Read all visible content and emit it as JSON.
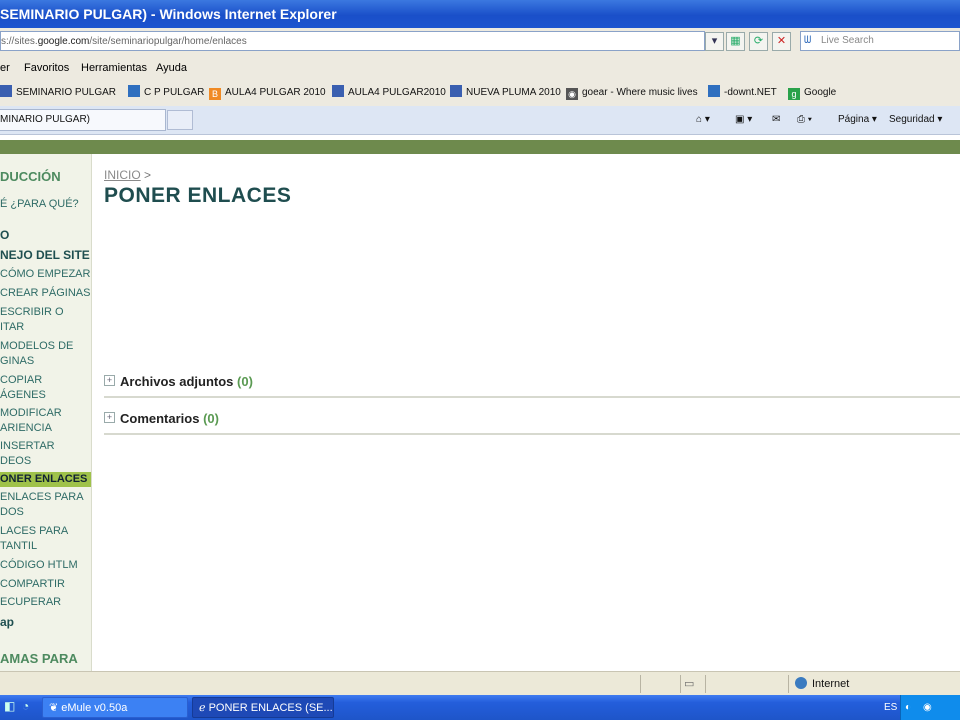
{
  "window": {
    "title": "SEMINARIO PULGAR) - Windows Internet Explorer"
  },
  "address": {
    "prefix": "s://sites.",
    "domain": "google.com",
    "path": "/site/seminariopulgar/home/enlaces",
    "search_placeholder": "Live Search"
  },
  "menu": {
    "items": [
      "er",
      "Favoritos",
      "Herramientas",
      "Ayuda"
    ]
  },
  "favorites": [
    {
      "label": "SEMINARIO PULGAR",
      "icon": "page-icon",
      "color": "#3a5fb0"
    },
    {
      "label": "C P PULGAR",
      "icon": "ie-page-icon",
      "color": "#2f6fbf"
    },
    {
      "label": "AULA4 PULGAR 2010",
      "icon": "blogger-icon",
      "color": "#f08a24"
    },
    {
      "label": "AULA4 PULGAR2010",
      "icon": "page-icon",
      "color": "#3a5fb0"
    },
    {
      "label": "NUEVA PLUMA 2010",
      "icon": "page-icon",
      "color": "#3a5fb0"
    },
    {
      "label": "goear - Where music lives",
      "icon": "goear-icon",
      "color": "#555555"
    },
    {
      "label": "-downt.NET",
      "icon": "ie-page-icon",
      "color": "#2f6fbf"
    },
    {
      "label": "Google",
      "icon": "google-icon",
      "color": "#2aa24a"
    }
  ],
  "tab": {
    "label": "MINARIO PULGAR)"
  },
  "command_bar": {
    "page": "Página",
    "security": "Seguridad"
  },
  "sidebar": {
    "items": [
      {
        "label": "DUCCIÓN",
        "style": "head"
      },
      {
        "label": "É ¿PARA QUÉ?",
        "style": "item"
      },
      {
        "label": "O",
        "style": "bold"
      },
      {
        "label": "NEJO DEL SITE",
        "style": "bold"
      },
      {
        "label": "CÓMO EMPEZAR",
        "style": "item"
      },
      {
        "label": "CREAR PÁGINAS",
        "style": "item"
      },
      {
        "label": "ESCRIBIR O",
        "style": "item"
      },
      {
        "label": "ITAR",
        "style": "item"
      },
      {
        "label": "MODELOS DE",
        "style": "item"
      },
      {
        "label": "GINAS",
        "style": "item"
      },
      {
        "label": "COPIAR",
        "style": "item"
      },
      {
        "label": "ÁGENES",
        "style": "item"
      },
      {
        "label": "MODIFICAR",
        "style": "item"
      },
      {
        "label": "ARIENCIA",
        "style": "item"
      },
      {
        "label": "INSERTAR",
        "style": "item"
      },
      {
        "label": "DEOS",
        "style": "item"
      },
      {
        "label": "ONER ENLACES",
        "style": "active"
      },
      {
        "label": "ENLACES PARA",
        "style": "item"
      },
      {
        "label": "DOS",
        "style": "item"
      },
      {
        "label": "LACES PARA",
        "style": "item"
      },
      {
        "label": "TANTIL",
        "style": "item"
      },
      {
        "label": "CÓDIGO HTLM",
        "style": "item"
      },
      {
        "label": "COMPARTIR",
        "style": "item"
      },
      {
        "label": "ECUPERAR",
        "style": "item"
      },
      {
        "label": "ap",
        "style": "bold"
      },
      {
        "label": "AMAS PARA",
        "style": "head"
      }
    ]
  },
  "main": {
    "breadcrumb": {
      "link": "INICIO",
      "sep": ">"
    },
    "title": "PONER ENLACES",
    "sections": [
      {
        "label": "Archivos adjuntos",
        "count": "(0)"
      },
      {
        "label": "Comentarios",
        "count": "(0)"
      }
    ]
  },
  "status": {
    "zone": "Internet"
  },
  "taskbar": {
    "tasks": [
      {
        "label": "eMule v0.50a",
        "active": false
      },
      {
        "label": "PONER ENLACES (SE...",
        "active": true
      }
    ],
    "lang": "ES"
  }
}
